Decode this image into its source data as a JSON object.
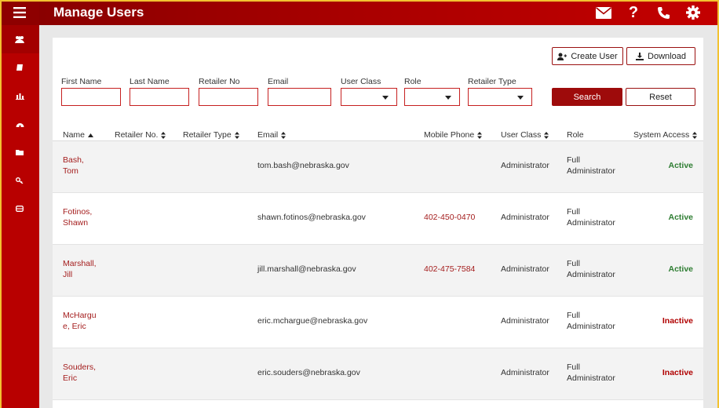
{
  "header": {
    "title": "Manage Users",
    "icons": [
      "envelope-icon",
      "help-icon",
      "phone-icon",
      "gear-icon"
    ],
    "help_label": "?"
  },
  "sidebar": {
    "icons": [
      "menu-icon",
      "users-icon",
      "book-icon",
      "bar-chart-icon",
      "dashboard-icon",
      "folder-icon",
      "key-icon",
      "printer-icon"
    ]
  },
  "actions": {
    "create_user": "Create User",
    "download": "Download"
  },
  "filters": {
    "first_name": "First Name",
    "last_name": "Last Name",
    "retailer_no": "Retailer No",
    "email": "Email",
    "user_class": "User Class",
    "role": "Role",
    "retailer_type": "Retailer Type",
    "search": "Search",
    "reset": "Reset"
  },
  "table": {
    "columns": {
      "name": "Name",
      "retailer_no": "Retailer No.",
      "retailer_type": "Retailer Type",
      "email": "Email",
      "mobile_phone": "Mobile Phone",
      "user_class": "User Class",
      "role": "Role",
      "system_access": "System Access"
    },
    "rows": [
      {
        "name_line1": "Bash,",
        "name_line2": "Tom",
        "email": "tom.bash@nebraska.gov",
        "phone": "",
        "user_class": "Administrator",
        "role_line1": "Full",
        "role_line2": "Administrator",
        "access": "Active"
      },
      {
        "name_line1": "Fotinos,",
        "name_line2": "Shawn",
        "email": "shawn.fotinos@nebraska.gov",
        "phone": "402-450-0470",
        "user_class": "Administrator",
        "role_line1": "Full",
        "role_line2": "Administrator",
        "access": "Active"
      },
      {
        "name_line1": "Marshall,",
        "name_line2": "Jill",
        "email": "jill.marshall@nebraska.gov",
        "phone": "402-475-7584",
        "user_class": "Administrator",
        "role_line1": "Full",
        "role_line2": "Administrator",
        "access": "Active"
      },
      {
        "name_line1": "McHargu",
        "name_line2": "e, Eric",
        "email": "eric.mchargue@nebraska.gov",
        "phone": "",
        "user_class": "Administrator",
        "role_line1": "Full",
        "role_line2": "Administrator",
        "access": "Inactive"
      },
      {
        "name_line1": "Souders,",
        "name_line2": "Eric",
        "email": "eric.souders@nebraska.gov",
        "phone": "",
        "user_class": "Administrator",
        "role_line1": "Full",
        "role_line2": "Administrator",
        "access": "Inactive"
      }
    ]
  },
  "colors": {
    "brand_red": "#b80000",
    "active_green": "#2e7d32",
    "inactive_red": "#b00000",
    "frame_yellow": "#f2c230"
  }
}
